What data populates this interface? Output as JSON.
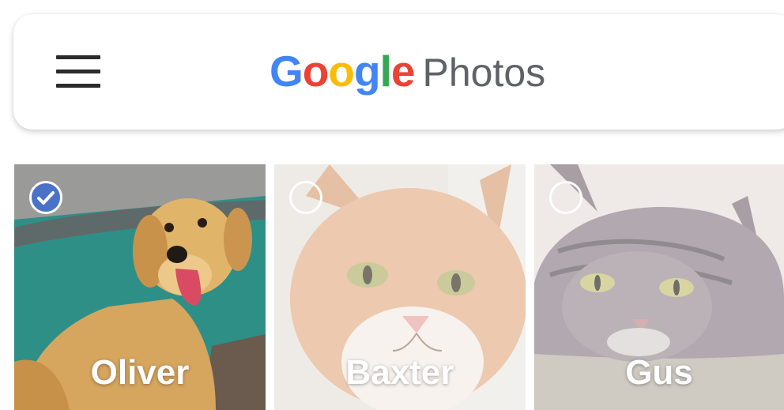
{
  "appbar": {
    "menu_icon": "hamburger-menu-icon",
    "brand": {
      "google_letters": [
        {
          "char": "G",
          "color": "#4285F4"
        },
        {
          "char": "o",
          "color": "#EA4335"
        },
        {
          "char": "o",
          "color": "#FBBC05"
        },
        {
          "char": "g",
          "color": "#4285F4"
        },
        {
          "char": "l",
          "color": "#34A853"
        },
        {
          "char": "e",
          "color": "#EA4335"
        }
      ],
      "product": "Photos",
      "product_color": "#5f6368"
    }
  },
  "grid": {
    "items": [
      {
        "name": "Oliver",
        "selected": true,
        "subject": "golden retriever dog"
      },
      {
        "name": "Baxter",
        "selected": false,
        "subject": "orange white cat"
      },
      {
        "name": "Gus",
        "selected": false,
        "subject": "gray tabby cat"
      }
    ]
  },
  "colors": {
    "select_check_fill": "#4a72c8",
    "label_text": "#ffffff"
  }
}
